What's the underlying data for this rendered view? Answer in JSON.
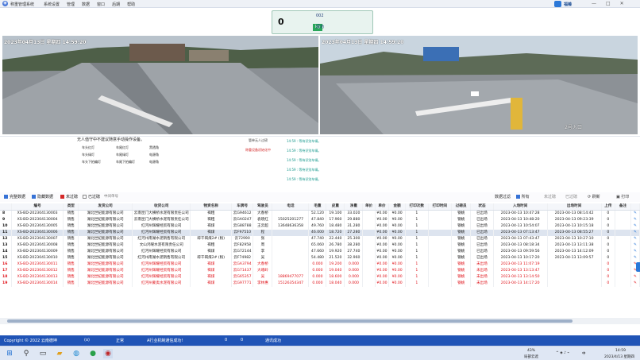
{
  "window": {
    "title": "称重管理系统",
    "menu": [
      "系统设置",
      "管理",
      "数据",
      "窗口",
      "后期",
      "帮助"
    ],
    "brand": "福榛"
  },
  "weight_panel": {
    "value": "0",
    "unit": "kg",
    "plate": "002",
    "state": "成功"
  },
  "cameras": [
    {
      "timestamp": "2023年04月13日 星期四 14:59:20",
      "label": ""
    },
    {
      "timestamp": "2023年04月13日 星期四 14:59:20",
      "label": "2号入口"
    }
  ],
  "notice": "无人值守中不建议随意手动操作设备。",
  "led_labels": [
    "车头红灯",
    "车尾红灯",
    "车头绿灯",
    "车尾绿灯",
    "车头下拍编灯",
    "车尾下拍编灯"
  ],
  "led_extra": [
    "黑透角",
    "电源角",
    "电源角"
  ],
  "lamp_status": [
    "管单无人过磅",
    "称重设备初始化中"
  ],
  "lamp_colors": [
    "#444444",
    "#d42828"
  ],
  "log_entries": [
    "14:59 : 等待识别车辆。",
    "14:59 : 等待识别车辆。",
    "14:59 : 等待识别车辆。",
    "14:59 : 等待识别车辆。",
    "14:59 : 等待识别车辆。"
  ],
  "filters": {
    "show_complete": "完整数据",
    "show_pending": "隐藏数据",
    "show_unfinished": "未过磅",
    "show_finished": "已过磅",
    "search_placeholder": "中间单号",
    "range_label": "数据过滤",
    "all": "所有",
    "not_passed": "未过磅",
    "passed": "已过磅",
    "refresh": "刷新",
    "print": "打印"
  },
  "table": {
    "columns": [
      "",
      "编号",
      "类型",
      "发货公司",
      "收货公司",
      "物资名称",
      "车牌号",
      "驾驶员",
      "电话",
      "毛重",
      "皮重",
      "净重",
      "单价",
      "单价",
      "金额",
      "打印次数",
      "打印时间",
      "过磅员",
      "状态",
      "入场时间",
      "出场时间",
      "上传",
      "备注",
      ""
    ],
    "rows": [
      {
        "n": "8",
        "id": "XS-BD-202304130003",
        "type": "销售",
        "from": "湖北世纪能源有限公司",
        "to": "云南昆门大横桥水泥有限责任公司",
        "goods": "褐粗",
        "plate": "云G94612",
        "driver": "大春桥",
        "phone": "",
        "gross": "52.120",
        "tare": "19.100",
        "net": "33.020",
        "price": "",
        "price2": "¥0.00",
        "amount": "¥0.00",
        "prints": "1",
        "ptime": "",
        "op": "钢姚",
        "status": "已出场",
        "in": "2023-04-13 10:47:28",
        "out": "2023-04-13 08:14:42",
        "up": "0",
        "memo": "",
        "kind": "done"
      },
      {
        "n": "9",
        "id": "XS-BD-202304130004",
        "type": "销售",
        "from": "湖北世纪能源有限公司",
        "to": "云南昆门大横桥水泥有限责任公司",
        "goods": "褐粗",
        "plate": "云GA0247",
        "driver": "袁晓红",
        "phone": "15025201277",
        "gross": "47.840",
        "tare": "17.960",
        "net": "29.880",
        "price": "",
        "price2": "¥0.00",
        "amount": "¥0.00",
        "prints": "1",
        "ptime": "",
        "op": "钢姚",
        "status": "已出场",
        "in": "2023-04-13 10:48:20",
        "out": "2023-04-13 09:23:39",
        "up": "0",
        "memo": "",
        "kind": "done"
      },
      {
        "n": "10",
        "id": "XS-BD-202304130005",
        "type": "销售",
        "from": "湖北世纪能源有限公司",
        "to": "红河州辉耀经贸有限公司",
        "goods": "褐煤",
        "plate": "云G88788",
        "driver": "王云超",
        "phone": "13648636358",
        "gross": "49.760",
        "tare": "18.480",
        "net": "31.280",
        "price": "",
        "price2": "¥0.00",
        "amount": "¥0.00",
        "prints": "1",
        "ptime": "",
        "op": "钢姚",
        "status": "已出场",
        "in": "2023-04-13 10:54:07",
        "out": "2023-04-13 10:15:18",
        "up": "0",
        "memo": "",
        "kind": "done"
      },
      {
        "n": "11",
        "id": "XS-BD-202304130006",
        "type": "销售",
        "from": "湖北世纪能源有限公司",
        "to": "红河州辉耀经贸有限公司",
        "goods": "褐煤",
        "plate": "云F97510",
        "driver": "程",
        "phone": "",
        "gross": "46.000",
        "tare": "18.720",
        "net": "27.280",
        "price": "",
        "price2": "¥0.00",
        "amount": "¥0.00",
        "prints": "1",
        "ptime": "",
        "op": "钢姚",
        "status": "已出场",
        "in": "2023-04-13 07:13:47",
        "out": "2023-04-13 08:55:27",
        "up": "0",
        "memo": "",
        "kind": "sel"
      },
      {
        "n": "12",
        "id": "XS-BD-202304130007",
        "type": "销售",
        "from": "湖北世纪能源有限公司",
        "to": "红河州南湖水泥销售有限公司",
        "goods": "碎干褐煤2# (粉)",
        "plate": "云72990",
        "driver": "张",
        "phone": "",
        "gross": "47.740",
        "tare": "22.440",
        "net": "25.300",
        "price": "",
        "price2": "¥0.00",
        "amount": "¥0.00",
        "prints": "1",
        "ptime": "",
        "op": "钢姚",
        "status": "已出场",
        "in": "2023-04-13 07:43:47",
        "out": "2023-04-13 10:27:10",
        "up": "0",
        "memo": "",
        "kind": "done"
      },
      {
        "n": "13",
        "id": "XS-BD-202304130008",
        "type": "销售",
        "from": "湖北世纪能源有限公司",
        "to": "文山鸿曜水泥有限责任公司",
        "goods": "褐粗",
        "plate": "云F82958",
        "driver": "周",
        "phone": "",
        "gross": "65.060",
        "tare": "26.780",
        "net": "38.280",
        "price": "",
        "price2": "¥0.00",
        "amount": "¥0.00",
        "prints": "1",
        "ptime": "",
        "op": "钢姚",
        "status": "已出场",
        "in": "2023-04-13 08:18:34",
        "out": "2023-04-13 13:11:38",
        "up": "0",
        "memo": "",
        "kind": "done"
      },
      {
        "n": "14",
        "id": "XS-BD-202304130009",
        "type": "销售",
        "from": "湖北世纪能源有限公司",
        "to": "红河州辉耀经贸有限公司",
        "goods": "褐煤",
        "plate": "云G72144",
        "driver": "李",
        "phone": "",
        "gross": "47.660",
        "tare": "19.920",
        "net": "27.740",
        "price": "",
        "price2": "¥0.00",
        "amount": "¥0.00",
        "prints": "1",
        "ptime": "",
        "op": "钢姚",
        "status": "已出场",
        "in": "2023-04-13 09:59:56",
        "out": "2023-04-13 14:12:09",
        "up": "0",
        "memo": "",
        "kind": "done"
      },
      {
        "n": "15",
        "id": "XS-BD-202304130010",
        "type": "销售",
        "from": "湖北世纪能源有限公司",
        "to": "红河州南湖水泥销售有限公司",
        "goods": "碎干褐煤2# (粉)",
        "plate": "云F74982",
        "driver": "吴",
        "phone": "",
        "gross": "54.480",
        "tare": "21.520",
        "net": "32.960",
        "price": "",
        "price2": "¥0.00",
        "amount": "¥0.00",
        "prints": "1",
        "ptime": "",
        "op": "钢姚",
        "status": "已出场",
        "in": "2023-04-13 10:17:20",
        "out": "2023-04-13 13:09:57",
        "up": "0",
        "memo": "",
        "kind": "done"
      },
      {
        "n": "16",
        "id": "XS-BD-202304130011",
        "type": "销售",
        "from": "湖北世纪能源有限公司",
        "to": "红河州辉耀经贸有限公司",
        "goods": "褐煤",
        "plate": "云GA3794",
        "driver": "大春桥",
        "phone": "",
        "gross": "0.000",
        "tare": "19.200",
        "net": "0.000",
        "price": "",
        "price2": "¥0.00",
        "amount": "¥0.00",
        "prints": "1",
        "ptime": "",
        "op": "钢姚",
        "status": "未出场",
        "in": "2023-04-13 11:07:19",
        "out": "",
        "up": "0",
        "memo": "",
        "kind": "pending"
      },
      {
        "n": "17",
        "id": "XS-BD-202304130012",
        "type": "销售",
        "from": "湖北世纪能源有限公司",
        "to": "红河州辉耀经贸有限公司",
        "goods": "褐煤",
        "plate": "云G71437",
        "driver": "大峨岭",
        "phone": "",
        "gross": "0.000",
        "tare": "19.040",
        "net": "0.000",
        "price": "",
        "price2": "¥0.00",
        "amount": "¥0.00",
        "prints": "1",
        "ptime": "",
        "op": "钢姚",
        "status": "未出场",
        "in": "2023-04-13 13:13:47",
        "out": "",
        "up": "0",
        "memo": "",
        "kind": "pending"
      },
      {
        "n": "18",
        "id": "XS-BD-202304130013",
        "type": "销售",
        "from": "湖北世纪能源有限公司",
        "to": "红河州辉耀经贸有限公司",
        "goods": "褐煤",
        "plate": "云G65357",
        "driver": "吴",
        "phone": "18869477077",
        "gross": "0.000",
        "tare": "18.600",
        "net": "0.000",
        "price": "",
        "price2": "¥0.00",
        "amount": "¥0.00",
        "prints": "1",
        "ptime": "",
        "op": "钢姚",
        "status": "未出场",
        "in": "2023-04-13 13:14:50",
        "out": "",
        "up": "0",
        "memo": "",
        "kind": "pending"
      },
      {
        "n": "19",
        "id": "XS-BD-202304130014",
        "type": "销售",
        "from": "湖北世纪能源有限公司",
        "to": "红河州蒙奥水泥有限公司",
        "goods": "褐煤",
        "plate": "云G97771",
        "driver": "李林惠",
        "phone": "15126354347",
        "gross": "0.000",
        "tare": "18.040",
        "net": "0.000",
        "price": "",
        "price2": "¥0.00",
        "amount": "¥0.00",
        "prints": "1",
        "ptime": "",
        "op": "钢姚",
        "status": "未出场",
        "in": "2023-04-13 14:17:20",
        "out": "",
        "up": "0",
        "memo": "",
        "kind": "pending"
      }
    ]
  },
  "status_bar": {
    "copyright": "Copyright © 2022 云南德坤",
    "mode": "正常",
    "msg": "A行业机制通信成功!",
    "count0": "0",
    "count1": "0",
    "msg2": "通讯成功"
  },
  "taskbar": {
    "battery": "43%",
    "weather": "局部云遮",
    "lang": "中",
    "time": "14:59",
    "date": "2023/4/13 星期四"
  }
}
